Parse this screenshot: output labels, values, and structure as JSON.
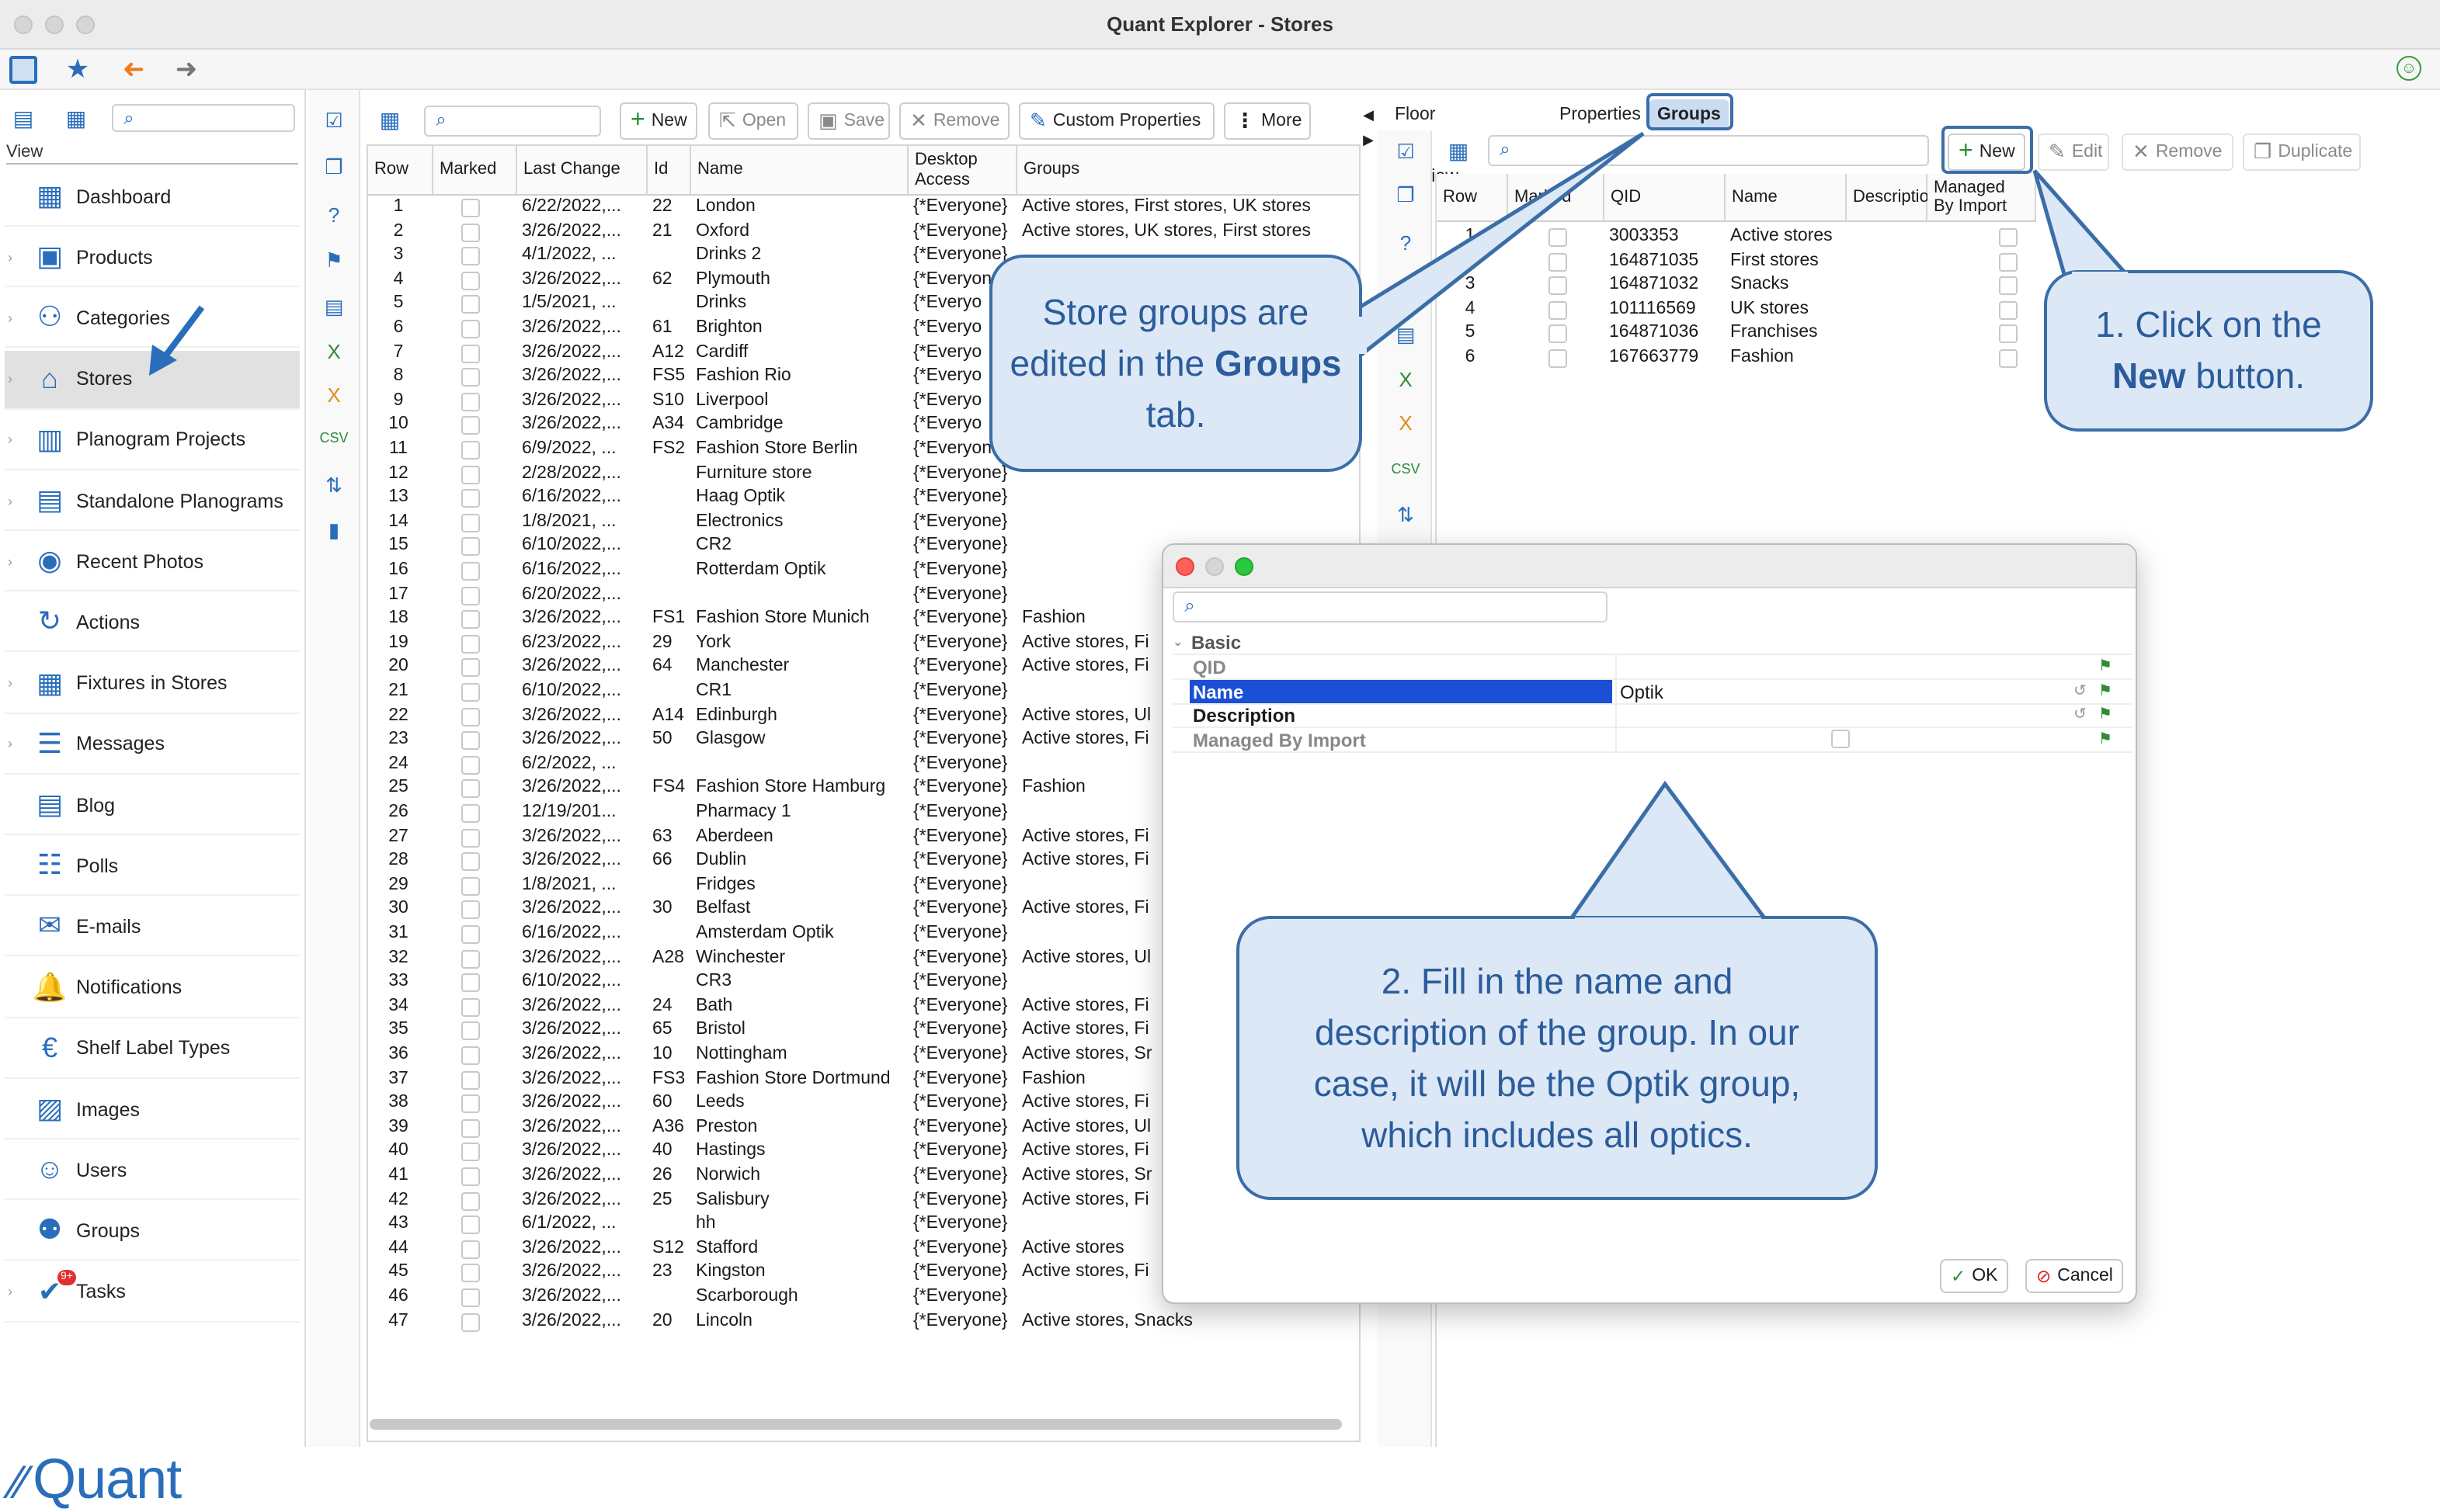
{
  "window": {
    "title": "Quant Explorer - Stores"
  },
  "sidebar": {
    "view_label": "View",
    "items": [
      {
        "label": "Dashboard",
        "icon": "dashboard-icon",
        "chevron": false
      },
      {
        "label": "Products",
        "icon": "products-icon",
        "chevron": true
      },
      {
        "label": "Categories",
        "icon": "categories-icon",
        "chevron": true
      },
      {
        "label": "Stores",
        "icon": "stores-icon",
        "chevron": true,
        "selected": true
      },
      {
        "label": "Planogram Projects",
        "icon": "planogram-projects-icon",
        "chevron": true
      },
      {
        "label": "Standalone Planograms",
        "icon": "standalone-planograms-icon",
        "chevron": true
      },
      {
        "label": "Recent Photos",
        "icon": "camera-icon",
        "chevron": true
      },
      {
        "label": "Actions",
        "icon": "actions-icon",
        "chevron": false
      },
      {
        "label": "Fixtures in Stores",
        "icon": "fixtures-icon",
        "chevron": true
      },
      {
        "label": "Messages",
        "icon": "messages-icon",
        "chevron": true
      },
      {
        "label": "Blog",
        "icon": "blog-icon",
        "chevron": false
      },
      {
        "label": "Polls",
        "icon": "polls-icon",
        "chevron": false
      },
      {
        "label": "E-mails",
        "icon": "email-icon",
        "chevron": false
      },
      {
        "label": "Notifications",
        "icon": "notifications-icon",
        "chevron": false
      },
      {
        "label": "Shelf Label Types",
        "icon": "shelf-label-icon",
        "chevron": false
      },
      {
        "label": "Images",
        "icon": "images-icon",
        "chevron": false
      },
      {
        "label": "Users",
        "icon": "users-icon",
        "chevron": false
      },
      {
        "label": "Groups",
        "icon": "groups-icon",
        "chevron": false
      },
      {
        "label": "Tasks",
        "icon": "tasks-icon",
        "chevron": true,
        "badge": "9+"
      }
    ],
    "logo_text": "Quant"
  },
  "toolbar": {
    "new": "New",
    "open": "Open",
    "save": "Save",
    "remove": "Remove",
    "custom_properties": "Custom Properties",
    "more": "More"
  },
  "stores_table": {
    "columns": [
      "Row",
      "Marked",
      "Last Change",
      "Id",
      "Name",
      "Desktop Access",
      "Groups"
    ],
    "rows": [
      [
        "1",
        "",
        "6/22/2022,...",
        "22",
        "London",
        "{*Everyone}",
        "Active stores, First stores, UK stores"
      ],
      [
        "2",
        "",
        "3/26/2022,...",
        "21",
        "Oxford",
        "{*Everyone}",
        "Active stores, UK stores, First stores"
      ],
      [
        "3",
        "",
        "4/1/2022, ...",
        "",
        "Drinks 2",
        "{*Everyone}",
        ""
      ],
      [
        "4",
        "",
        "3/26/2022,...",
        "62",
        "Plymouth",
        "{*Everyon",
        ""
      ],
      [
        "5",
        "",
        "1/5/2021, ...",
        "",
        "Drinks",
        "{*Everyo",
        ""
      ],
      [
        "6",
        "",
        "3/26/2022,...",
        "61",
        "Brighton",
        "{*Everyo",
        ""
      ],
      [
        "7",
        "",
        "3/26/2022,...",
        "A12",
        "Cardiff",
        "{*Everyo",
        ""
      ],
      [
        "8",
        "",
        "3/26/2022,...",
        "FS5",
        "Fashion Rio",
        "{*Everyo",
        ""
      ],
      [
        "9",
        "",
        "3/26/2022,...",
        "S10",
        "Liverpool",
        "{*Everyo",
        ""
      ],
      [
        "10",
        "",
        "3/26/2022,...",
        "A34",
        "Cambridge",
        "{*Everyo",
        ""
      ],
      [
        "11",
        "",
        "6/9/2022, ...",
        "FS2",
        "Fashion Store Berlin",
        "{*Everyon",
        ""
      ],
      [
        "12",
        "",
        "2/28/2022,...",
        "",
        "Furniture store",
        "{*Everyone}",
        ""
      ],
      [
        "13",
        "",
        "6/16/2022,...",
        "",
        "Haag Optik",
        "{*Everyone}",
        ""
      ],
      [
        "14",
        "",
        "1/8/2021, ...",
        "",
        "Electronics",
        "{*Everyone}",
        ""
      ],
      [
        "15",
        "",
        "6/10/2022,...",
        "",
        "CR2",
        "{*Everyone}",
        ""
      ],
      [
        "16",
        "",
        "6/16/2022,...",
        "",
        "Rotterdam Optik",
        "{*Everyone}",
        ""
      ],
      [
        "17",
        "",
        "6/20/2022,...",
        "",
        "",
        "{*Everyone}",
        ""
      ],
      [
        "18",
        "",
        "3/26/2022,...",
        "FS1",
        "Fashion Store Munich",
        "{*Everyone}",
        "Fashion"
      ],
      [
        "19",
        "",
        "6/23/2022,...",
        "29",
        "York",
        "{*Everyone}",
        "Active stores, Fi"
      ],
      [
        "20",
        "",
        "3/26/2022,...",
        "64",
        "Manchester",
        "{*Everyone}",
        "Active stores, Fi"
      ],
      [
        "21",
        "",
        "6/10/2022,...",
        "",
        "CR1",
        "{*Everyone}",
        ""
      ],
      [
        "22",
        "",
        "3/26/2022,...",
        "A14",
        "Edinburgh",
        "{*Everyone}",
        "Active stores, Ul"
      ],
      [
        "23",
        "",
        "3/26/2022,...",
        "50",
        "Glasgow",
        "{*Everyone}",
        "Active stores, Fi"
      ],
      [
        "24",
        "",
        "6/2/2022, ...",
        "",
        "",
        "{*Everyone}",
        ""
      ],
      [
        "25",
        "",
        "3/26/2022,...",
        "FS4",
        "Fashion Store Hamburg",
        "{*Everyone}",
        "Fashion"
      ],
      [
        "26",
        "",
        "12/19/201...",
        "",
        "Pharmacy 1",
        "{*Everyone}",
        ""
      ],
      [
        "27",
        "",
        "3/26/2022,...",
        "63",
        "Aberdeen",
        "{*Everyone}",
        "Active stores, Fi"
      ],
      [
        "28",
        "",
        "3/26/2022,...",
        "66",
        "Dublin",
        "{*Everyone}",
        "Active stores, Fi"
      ],
      [
        "29",
        "",
        "1/8/2021, ...",
        "",
        "Fridges",
        "{*Everyone}",
        ""
      ],
      [
        "30",
        "",
        "3/26/2022,...",
        "30",
        "Belfast",
        "{*Everyone}",
        "Active stores, Fi"
      ],
      [
        "31",
        "",
        "6/16/2022,...",
        "",
        "Amsterdam Optik",
        "{*Everyone}",
        ""
      ],
      [
        "32",
        "",
        "3/26/2022,...",
        "A28",
        "Winchester",
        "{*Everyone}",
        "Active stores, Ul"
      ],
      [
        "33",
        "",
        "6/10/2022,...",
        "",
        "CR3",
        "{*Everyone}",
        ""
      ],
      [
        "34",
        "",
        "3/26/2022,...",
        "24",
        "Bath",
        "{*Everyone}",
        "Active stores, Fi"
      ],
      [
        "35",
        "",
        "3/26/2022,...",
        "65",
        "Bristol",
        "{*Everyone}",
        "Active stores, Fi"
      ],
      [
        "36",
        "",
        "3/26/2022,...",
        "10",
        "Nottingham",
        "{*Everyone}",
        "Active stores, Sr"
      ],
      [
        "37",
        "",
        "3/26/2022,...",
        "FS3",
        "Fashion Store Dortmund",
        "{*Everyone}",
        "Fashion"
      ],
      [
        "38",
        "",
        "3/26/2022,...",
        "60",
        "Leeds",
        "{*Everyone}",
        "Active stores, Fi"
      ],
      [
        "39",
        "",
        "3/26/2022,...",
        "A36",
        "Preston",
        "{*Everyone}",
        "Active stores, Ul"
      ],
      [
        "40",
        "",
        "3/26/2022,...",
        "40",
        "Hastings",
        "{*Everyone}",
        "Active stores, Fi"
      ],
      [
        "41",
        "",
        "3/26/2022,...",
        "26",
        "Norwich",
        "{*Everyone}",
        "Active stores, Sr"
      ],
      [
        "42",
        "",
        "3/26/2022,...",
        "25",
        "Salisbury",
        "{*Everyone}",
        "Active stores, Fi"
      ],
      [
        "43",
        "",
        "6/1/2022, ...",
        "",
        "hh",
        "{*Everyone}",
        ""
      ],
      [
        "44",
        "",
        "3/26/2022,...",
        "S12",
        "Stafford",
        "{*Everyone}",
        "Active stores"
      ],
      [
        "45",
        "",
        "3/26/2022,...",
        "23",
        "Kingston",
        "{*Everyone}",
        "Active stores, Fi"
      ],
      [
        "46",
        "",
        "3/26/2022,...",
        "",
        "Scarborough",
        "{*Everyone}",
        ""
      ],
      [
        "47",
        "",
        "3/26/2022,...",
        "20",
        "Lincoln",
        "{*Everyone}",
        "Active stores, Snacks"
      ]
    ]
  },
  "right_panel": {
    "tabs": [
      "Floor Plan Preview",
      "Properties",
      "Groups"
    ],
    "active_tab": "Groups",
    "toolbar": {
      "new": "New",
      "edit": "Edit",
      "remove": "Remove",
      "duplicate": "Duplicate"
    },
    "columns": [
      "Row",
      "Marked",
      "QID",
      "Name",
      "Description",
      "Managed By Import"
    ],
    "rows": [
      [
        "1",
        "",
        "3003353",
        "Active stores"
      ],
      [
        "2",
        "",
        "164871035",
        "First stores"
      ],
      [
        "3",
        "",
        "164871032",
        "Snacks"
      ],
      [
        "4",
        "",
        "101116569",
        "UK stores"
      ],
      [
        "5",
        "",
        "164871036",
        "Franchises"
      ],
      [
        "6",
        "",
        "167663779",
        "Fashion"
      ]
    ]
  },
  "dialog": {
    "section": "Basic",
    "fields": [
      {
        "label": "QID",
        "value": ""
      },
      {
        "label": "Name",
        "value": "Optik"
      },
      {
        "label": "Description",
        "value": ""
      },
      {
        "label": "Managed By Import",
        "value": ""
      }
    ],
    "ok": "OK",
    "cancel": "Cancel"
  },
  "callouts": {
    "groups_tab": {
      "pre": "Store groups are edited in the",
      "bold": "Groups",
      "post": "tab."
    },
    "new_button": {
      "pre": "1. Click on the",
      "bold": "New",
      "post": "button."
    },
    "fill_in": "2. Fill in the name and description of the group. In our case, it will be the Optik group, which includes all optics."
  },
  "colors": {
    "accent": "#2a6ebb",
    "callout_fill": "#dde8f6",
    "callout_border": "#3b6ea8",
    "selection": "#1a4fd6"
  }
}
